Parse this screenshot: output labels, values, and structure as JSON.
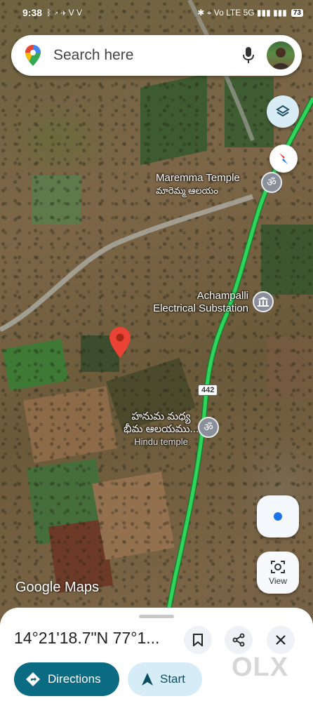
{
  "status_bar": {
    "time": "9:38",
    "left_icons": "ᛒ ↗ ✈ V V",
    "right_icons": "✱ ⌖ Vo LTE 5G ▮▮▮ ▮▮▮",
    "battery": "73"
  },
  "search": {
    "placeholder": "Search here"
  },
  "map": {
    "places": [
      {
        "name": "Maremma Temple",
        "local_name": "మారెమ్మ ఆలయం",
        "icon": "om-icon"
      },
      {
        "name": "Achampalli",
        "line2": "Electrical Substation",
        "icon": "building-icon"
      },
      {
        "name": "హనుమ మధ్య",
        "line2": "భీమ ఆలయము...",
        "category": "Hindu temple",
        "icon": "om-icon"
      }
    ],
    "route_shield": "442",
    "logo_text": "Google Maps"
  },
  "buttons": {
    "view_label": "View"
  },
  "sheet": {
    "coordinates": "14°21'18.7\"N 77°1...",
    "directions_label": "Directions",
    "start_label": "Start"
  },
  "watermark": "OLX",
  "colors": {
    "route": "#2fd55a",
    "pin": "#ea4335",
    "directions_bg": "#0b6b83",
    "start_bg": "#d6ecf6"
  }
}
